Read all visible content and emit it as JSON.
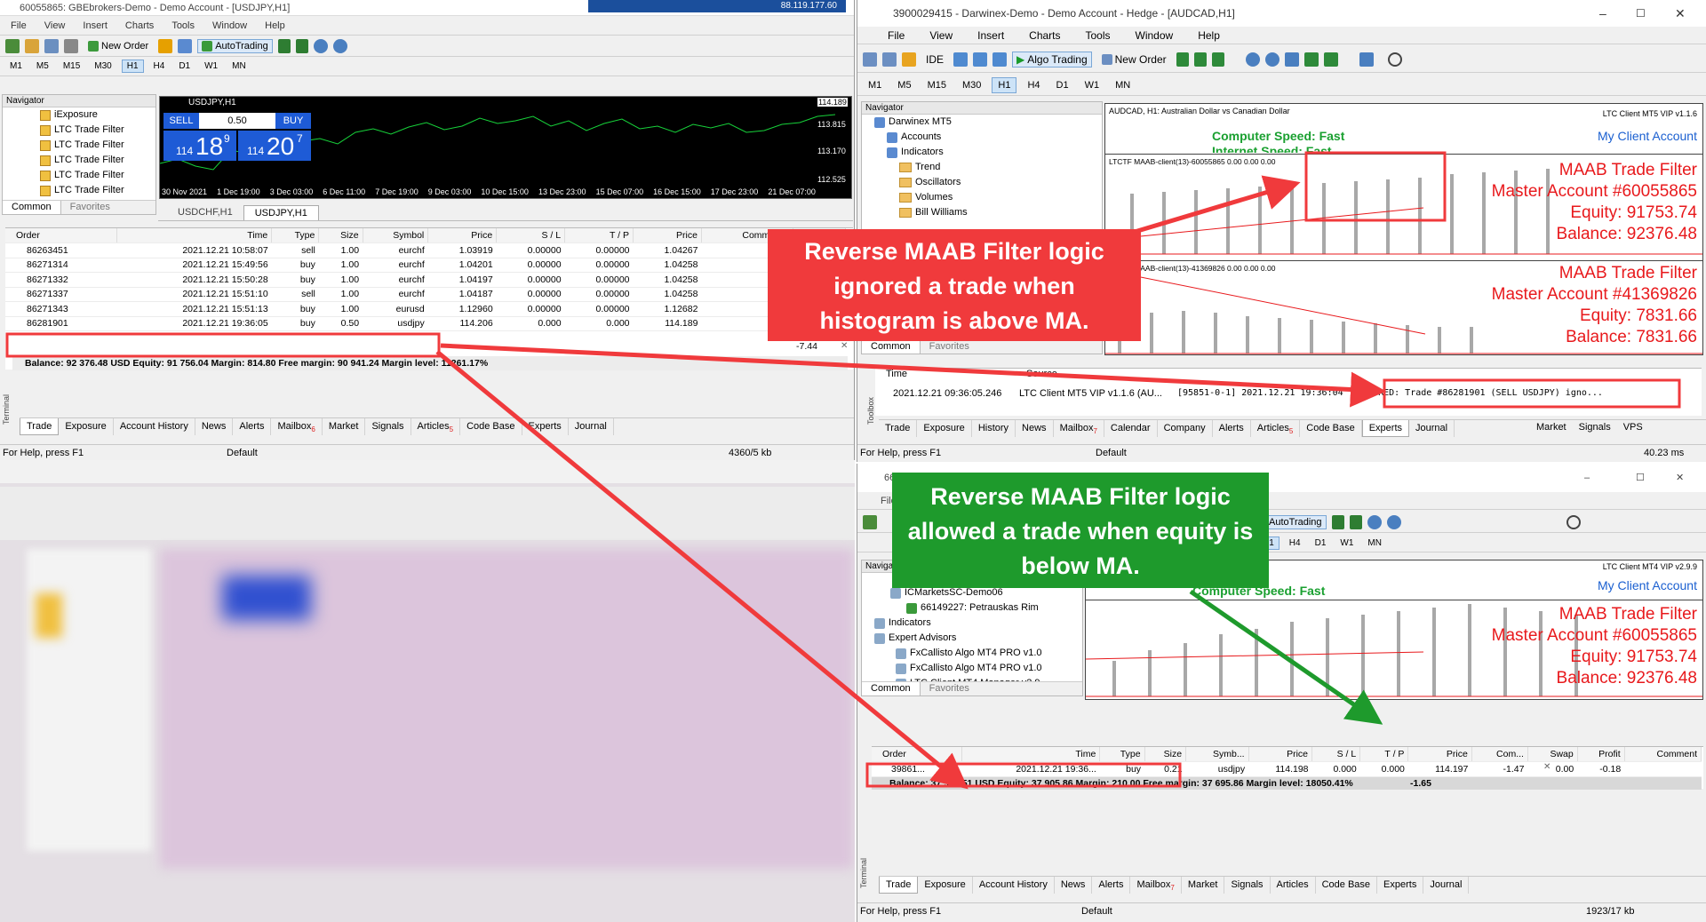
{
  "left": {
    "title": "60055865: GBEbrokers-Demo - Demo Account - [USDJPY,H1]",
    "menu": [
      "File",
      "View",
      "Insert",
      "Charts",
      "Tools",
      "Window",
      "Help"
    ],
    "new_order": "New Order",
    "autotrading": "AutoTrading",
    "timeframes": [
      "M1",
      "M5",
      "M15",
      "M30",
      "H1",
      "H4",
      "D1",
      "W1",
      "MN"
    ],
    "navigator": {
      "title": "Navigator",
      "items": [
        "iExposure",
        "LTC Trade Filter",
        "LTC Trade Filter",
        "LTC Trade Filter",
        "LTC Trade Filter",
        "LTC Trade Filter"
      ],
      "tabs": [
        "Common",
        "Favorites"
      ]
    },
    "chart": {
      "header": "USDJPY,H1",
      "sell": "SELL",
      "buy": "BUY",
      "lot": "0.50",
      "sell_big": "114",
      "sell_pts": "18",
      "sell_sup": "9",
      "buy_big": "114",
      "buy_pts": "20",
      "buy_sup": "7",
      "prices": [
        "114.189",
        "113.815",
        "113.170",
        "112.525"
      ],
      "dates": [
        "30 Nov 2021",
        "1 Dec 19:00",
        "3 Dec 03:00",
        "6 Dec 11:00",
        "7 Dec 19:00",
        "9 Dec 03:00",
        "10 Dec 15:00",
        "13 Dec 23:00",
        "15 Dec 07:00",
        "16 Dec 15:00",
        "17 Dec 23:00",
        "21 Dec 07:00"
      ],
      "tabs": [
        "USDCHF,H1",
        "USDJPY,H1"
      ]
    },
    "orders": {
      "headers": [
        "Order",
        "Time",
        "Type",
        "Size",
        "Symbol",
        "Price",
        "S / L",
        "T / P",
        "Price",
        "Commiss...",
        "Swap"
      ],
      "rows": [
        [
          "86263451",
          "2021.12.21 10:58:07",
          "sell",
          "1.00",
          "eurchf",
          "1.03919",
          "0.00000",
          "0.00000",
          "1.04267",
          "0.00",
          "0.00"
        ],
        [
          "86271314",
          "2021.12.21 15:49:56",
          "buy",
          "1.00",
          "eurchf",
          "1.04201",
          "0.00000",
          "0.00000",
          "1.04258",
          "0.00",
          "0.00"
        ],
        [
          "86271332",
          "2021.12.21 15:50:28",
          "buy",
          "1.00",
          "eurchf",
          "1.04197",
          "0.00000",
          "0.00000",
          "1.04258",
          "0.00",
          "0.00"
        ],
        [
          "86271337",
          "2021.12.21 15:51:10",
          "sell",
          "1.00",
          "eurchf",
          "1.04187",
          "0.00000",
          "0.00000",
          "1.04258",
          "0.00",
          "0.00"
        ],
        [
          "86271343",
          "2021.12.21 15:51:13",
          "buy",
          "1.00",
          "eurusd",
          "1.12960",
          "0.00000",
          "0.00000",
          "1.12682",
          "0.00",
          "0.00"
        ],
        [
          "86281901",
          "2021.12.21 19:36:05",
          "buy",
          "0.50",
          "usdjpy",
          "114.206",
          "0.000",
          "0.000",
          "114.189",
          "0.00",
          "0.00"
        ]
      ],
      "last_profit": "-7.44",
      "balance": "Balance: 92 376.48 USD  Equity: 91 756.04  Margin: 814.80  Free margin: 90 941.24  Margin level: 11261.17%"
    },
    "terminal_label": "Terminal",
    "tabs": [
      "Trade",
      "Exposure",
      "Account History",
      "News",
      "Alerts",
      "Mailbox",
      "Market",
      "Signals",
      "Articles",
      "Code Base",
      "Experts",
      "Journal"
    ],
    "mailbox_count": "6",
    "articles_count": "5",
    "status": {
      "help": "For Help, press F1",
      "profile": "Default",
      "traffic": "4360/5 kb"
    }
  },
  "taskbar": {
    "ip": "88.119.177.60"
  },
  "right_top": {
    "title": "3900029415 - Darwinex-Demo - Demo Account - Hedge - [AUDCAD,H1]",
    "menu": [
      "File",
      "View",
      "Insert",
      "Charts",
      "Tools",
      "Window",
      "Help"
    ],
    "ide": "IDE",
    "algo": "Algo Trading",
    "new_order": "New Order",
    "timeframes": [
      "M1",
      "M5",
      "M15",
      "M30",
      "H1",
      "H4",
      "D1",
      "W1",
      "MN"
    ],
    "navigator": {
      "title": "Navigator",
      "items": [
        "Darwinex MT5",
        "Accounts",
        "Indicators",
        "Trend",
        "Oscillators",
        "Volumes",
        "Bill Williams"
      ],
      "tabs": [
        "Common",
        "Favorites"
      ]
    },
    "chart_title": "AUDCAD, H1:  Australian Dollar vs Canadian Dollar",
    "ea_label": "LTC Client MT5 VIP v1.1.6",
    "speed": "Computer Speed: Fast",
    "speed2": "Internet Speed: Fast",
    "client_account": "My Client Account",
    "sub1": {
      "label": "LTCTF MAAB-client(13)-60055865 0.00 0.00 0.00",
      "lines": [
        "MAAB Trade Filter",
        "Master Account #60055865",
        "Equity: 91753.74",
        "Balance: 92376.48"
      ]
    },
    "sub2": {
      "label": "LTCTF MAAB-client(13)-41369826 0.00 0.00 0.00",
      "lines": [
        "MAAB Trade Filter",
        "Master Account #41369826",
        "Equity: 7831.66",
        "Balance: 7831.66"
      ]
    },
    "log": {
      "h1": "Time",
      "h2": "Source",
      "time": "2021.12.21 09:36:05.246",
      "source": "LTC Client MT5 VIP v1.1.6 (AU...",
      "message_pre": "[95851-0-1] 2021.12.21 19:36:04",
      "message": "IGNORED: Trade #86281901 (SELL USDJPY) igno..."
    },
    "toolbox_label": "Toolbox",
    "tabs": [
      "Trade",
      "Exposure",
      "History",
      "News",
      "Mailbox",
      "Calendar",
      "Company",
      "Alerts",
      "Articles",
      "Code Base",
      "Experts",
      "Journal"
    ],
    "market": "Market",
    "signals": "Signals",
    "vps": "VPS",
    "mailbox_count": "7",
    "articles_count": "5",
    "status": {
      "help": "For Help, press F1",
      "profile": "Default",
      "ping": "40.23 ms"
    }
  },
  "right_bottom": {
    "title_num": "66",
    "menu_first": "File",
    "autotrading": "AutoTrading",
    "timeframes": [
      "H1",
      "H4",
      "D1",
      "W1",
      "MN"
    ],
    "navigator": {
      "title": "Navigator",
      "items": [
        "ICMarketsSC-Demo06",
        "66149227: Petrauskas Rim",
        "Indicators",
        "Expert Advisors",
        "FxCallisto Algo MT4 PRO v1.0",
        "FxCallisto Algo MT4 PRO v1.0",
        "LTC Client MT4 Manager v2.9"
      ],
      "tabs": [
        "Common",
        "Favorites"
      ]
    },
    "ea_label": "LTC Client MT4 VIP v2.9.9",
    "speed": "Computer Speed: Fast",
    "client_account": "My Client Account",
    "lines": [
      "MAAB Trade Filter",
      "Master Account #60055865",
      "Equity: 91753.74",
      "Balance: 92376.48"
    ],
    "orders": {
      "headers": [
        "Order",
        "Time",
        "Type",
        "Size",
        "Symb...",
        "Price",
        "S / L",
        "T / P",
        "Price",
        "Com...",
        "Swap",
        "Profit",
        "Comment"
      ],
      "row": [
        "39861...",
        "2021.12.21 19:36...",
        "buy",
        "0.21",
        "usdjpy",
        "114.198",
        "0.000",
        "0.000",
        "114.197",
        "-1.47",
        "0.00",
        "-0.18"
      ],
      "balance": "Balance: 37 907.51 USD  Equity: 37 905.86  Margin: 210.00  Free margin: 37 695.86  Margin level: 18050.41%",
      "total": "-1.65"
    },
    "terminal_label": "Terminal",
    "tabs": [
      "Trade",
      "Exposure",
      "Account History",
      "News",
      "Alerts",
      "Mailbox",
      "Market",
      "Signals",
      "Articles",
      "Code Base",
      "Experts",
      "Journal"
    ],
    "mailbox_count": "7",
    "status": {
      "help": "For Help, press F1",
      "profile": "Default",
      "traffic": "1923/17 kb"
    }
  },
  "callouts": {
    "red": "Reverse MAAB Filter logic ignored a trade when histogram is above MA.",
    "green": "Reverse MAAB Filter logic allowed a trade when equity is below MA."
  },
  "colors": {
    "annotation_red": "#f03a3c",
    "annotation_green": "#1e9a2c",
    "chart_red": "#e8191c",
    "link_blue": "#1a5fd0"
  }
}
